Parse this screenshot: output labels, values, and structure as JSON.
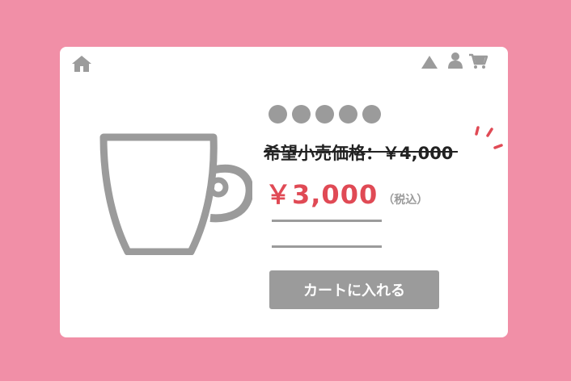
{
  "header": {
    "icons": [
      "home-icon",
      "warning-icon",
      "user-icon",
      "cart-icon"
    ]
  },
  "product": {
    "image": "coffee-cup-icon",
    "rating_dots": 5,
    "list_price": "希望小売価格：￥4,000",
    "sale_price": "￥3,000",
    "tax_note": "（税込）",
    "add_to_cart_label": "カートに入れる"
  },
  "colors": {
    "background": "#f18fa7",
    "card": "#ffffff",
    "icon_gray": "#9b9b9b",
    "sale_price": "#e04a55",
    "accent": "#e04a55"
  }
}
